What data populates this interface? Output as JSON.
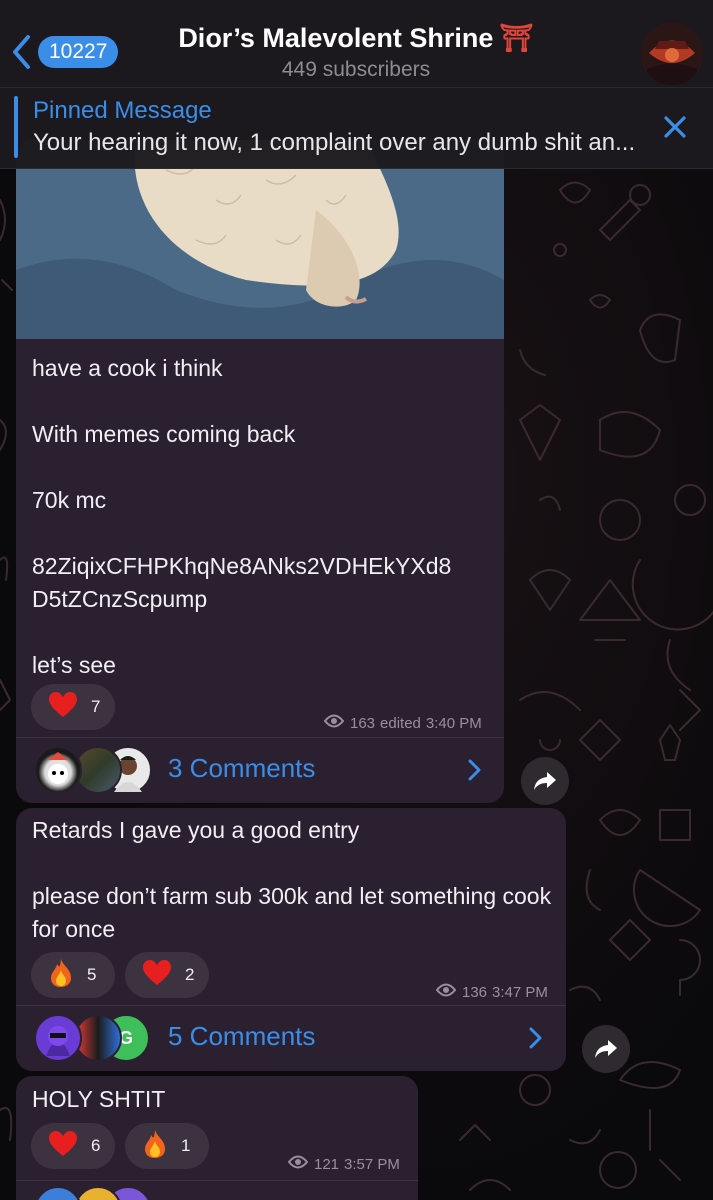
{
  "header": {
    "back_badge": "10227",
    "channel_title": "Dior’s Malevolent Shrine",
    "channel_emoji": "⛩",
    "subscribers": "449 subscribers"
  },
  "pinned": {
    "title": "Pinned Message",
    "text": "Your hearing it now, 1 complaint over any dumb shit an..."
  },
  "messages": [
    {
      "text": "have a cook i think\n\nWith memes coming back\n\n70k mc\n\n82ZiqixCFHPKhqNe8ANks2VDHEkYXd8\nD5tZCnzScpump\n\nlet’s see",
      "reactions": [
        {
          "emoji": "heart",
          "count": "7"
        }
      ],
      "views": "163",
      "edited": "edited",
      "time": "3:40 PM",
      "comments": "3 Comments"
    },
    {
      "text": "Retards I gave you a good entry\n\nplease don’t farm sub 300k and let something cook for once",
      "reactions": [
        {
          "emoji": "fire",
          "count": "5"
        },
        {
          "emoji": "heart",
          "count": "2"
        }
      ],
      "views": "136",
      "time": "3:47 PM",
      "comments": "5 Comments"
    },
    {
      "text": "HOLY SHTIT",
      "reactions": [
        {
          "emoji": "heart",
          "count": "6"
        },
        {
          "emoji": "fire",
          "count": "1"
        }
      ],
      "views": "121",
      "time": "3:57 PM"
    }
  ],
  "colors": {
    "accent": "#3b8ee8",
    "bubble": "#2b2030",
    "background": "#0b0a0c"
  }
}
